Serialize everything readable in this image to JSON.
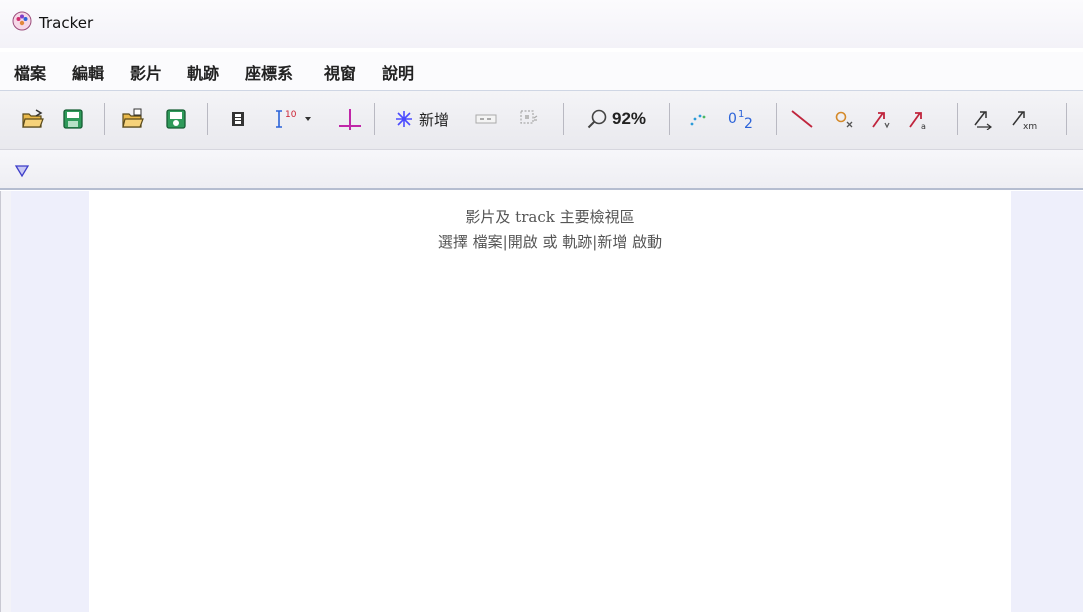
{
  "window": {
    "title": "Tracker"
  },
  "menu": [
    "檔案",
    "編輯",
    "影片",
    "軌跡",
    "座標系",
    "視窗",
    "說明"
  ],
  "toolbar": {
    "new_track_label": "新增",
    "zoom_level": "92%"
  },
  "viewer": {
    "line1": "影片及 track 主要檢視區",
    "line2": "選擇 檔案|開啟 或 軌跡|新增 啟動"
  }
}
